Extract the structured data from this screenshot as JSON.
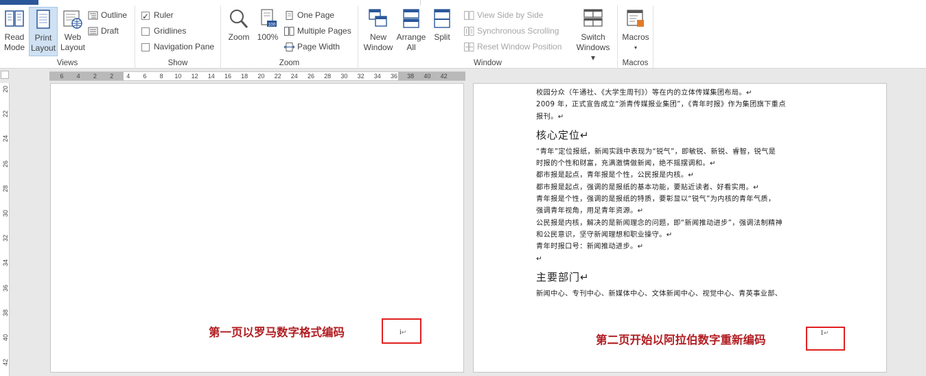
{
  "ribbon": {
    "views": {
      "label": "Views",
      "read_mode": [
        "Read",
        "Mode"
      ],
      "print_layout": [
        "Print",
        "Layout"
      ],
      "web_layout": [
        "Web",
        "Layout"
      ],
      "outline": "Outline",
      "draft": "Draft"
    },
    "show": {
      "label": "Show",
      "ruler": "Ruler",
      "ruler_checked": true,
      "gridlines": "Gridlines",
      "gridlines_checked": false,
      "navigation_pane": "Navigation Pane",
      "navigation_pane_checked": false
    },
    "zoom": {
      "label": "Zoom",
      "zoom": "Zoom",
      "hundred": "100%",
      "one_page": "One Page",
      "multiple_pages": "Multiple Pages",
      "page_width": "Page Width"
    },
    "window": {
      "label": "Window",
      "new_window": [
        "New",
        "Window"
      ],
      "arrange_all": [
        "Arrange",
        "All"
      ],
      "split": "Split",
      "view_side_by_side": "View Side by Side",
      "synchronous_scrolling": "Synchronous Scrolling",
      "reset_window_position": "Reset Window Position",
      "switch_windows": [
        "Switch",
        "Windows ▾"
      ]
    },
    "macros": {
      "label": "Macros",
      "macros": "Macros",
      "arrow": "▾"
    }
  },
  "hruler_ticks": [
    "6",
    "4",
    "2",
    "2",
    "4",
    "6",
    "8",
    "10",
    "12",
    "14",
    "16",
    "18",
    "20",
    "22",
    "24",
    "26",
    "28",
    "30",
    "32",
    "34",
    "36",
    "38",
    "40",
    "42"
  ],
  "vruler_ticks": [
    "20",
    "22",
    "24",
    "26",
    "28",
    "30",
    "32",
    "34",
    "36",
    "38",
    "40",
    "42"
  ],
  "page2": {
    "lines_a": [
      "校园分众（午通社、《大学生周刊》）等在内的立体传媒集团布局。↵",
      "2009 年，正式宣告成立“浙青传媒报业集团”，《青年时报》作为集团旗下重点",
      "报刊。↵"
    ],
    "heading1": "核心定位↵",
    "lines_b": [
      "“青年”定位报纸，新闻实践中表现为“锐气”，即敏锐、新锐、睿智，锐气是",
      "时报的个性和财富，充满激情做新闻，绝不摇摆调和。↵",
      "都市报是起点，青年报是个性，公民报是内核。↵",
      "都市报是起点，强调的是报纸的基本功能，要贴近读者、好看实用。↵",
      "青年报是个性，强调的是报纸的特质，要彰显以“锐气”为内核的青年气质，",
      "强调青年视角，用足青年资源。↵",
      "公民报是内核，解决的是新闻理念的问题，即“新闻推动进步”，强调法制精神",
      "和公民意识，坚守新闻理想和职业操守。↵",
      "青年时报口号：新闻推动进步。↵",
      "↵"
    ],
    "heading2": "主要部门↵",
    "lines_c": [
      "新闻中心、专刊中心、新媒体中心、文体新闻中心、视觉中心、青英事业部、"
    ],
    "annotation": "第二页开始以阿拉伯数字重新编码",
    "page_number": "1",
    "para_mark": "↵"
  },
  "page1": {
    "annotation": "第一页以罗马数字格式编码",
    "page_number": "i",
    "para_mark": "↵"
  },
  "colors": {
    "annotation_text": "#b21f24",
    "annotation_box": "#e02020",
    "accent": "#2b579a"
  }
}
